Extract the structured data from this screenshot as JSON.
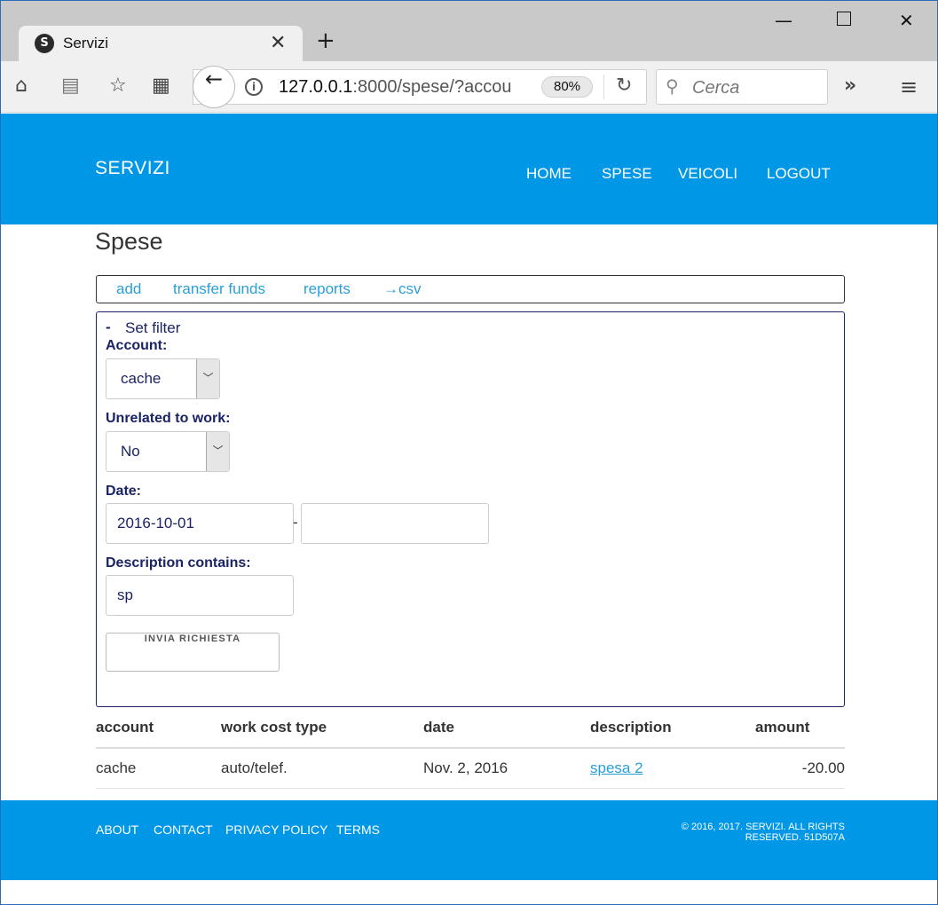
{
  "browser": {
    "tab_title": "Servizi",
    "tab_favicon_letter": "S",
    "url_host": "127.0.0.1",
    "url_rest": ":8000/spese/?accou",
    "zoom": "80%",
    "search_placeholder": "Cerca"
  },
  "header": {
    "brand": "SERVIZI",
    "nav": [
      "HOME",
      "SPESE",
      "VEICOLI",
      "LOGOUT"
    ]
  },
  "main": {
    "title": "Spese",
    "actions": [
      "add",
      "transfer funds",
      "reports",
      "→csv"
    ]
  },
  "filter": {
    "toggle_symbol": "-",
    "toggle_label": "Set filter",
    "account_label": "Account:",
    "account_value": "cache",
    "unrelated_label": "Unrelated to work:",
    "unrelated_value": "No",
    "date_label": "Date:",
    "date_from": "2016-10-01",
    "date_to": "",
    "date_sep": "-",
    "description_label": "Description contains:",
    "description_value": "sp",
    "submit_label": "INVIA RICHIESTA"
  },
  "table": {
    "headers": [
      "account",
      "work cost type",
      "date",
      "description",
      "amount"
    ],
    "rows": [
      [
        "cache",
        "auto/telef.",
        "Nov. 2, 2016",
        "spesa 2",
        "-20.00"
      ]
    ]
  },
  "footer": {
    "links": [
      "ABOUT",
      "CONTACT",
      "PRIVACY POLICY",
      "TERMS"
    ],
    "copyright_line1": "© 2016, 2017. SERVIZI. ALL RIGHTS",
    "copyright_line2": "RESERVED. 51D507A"
  }
}
